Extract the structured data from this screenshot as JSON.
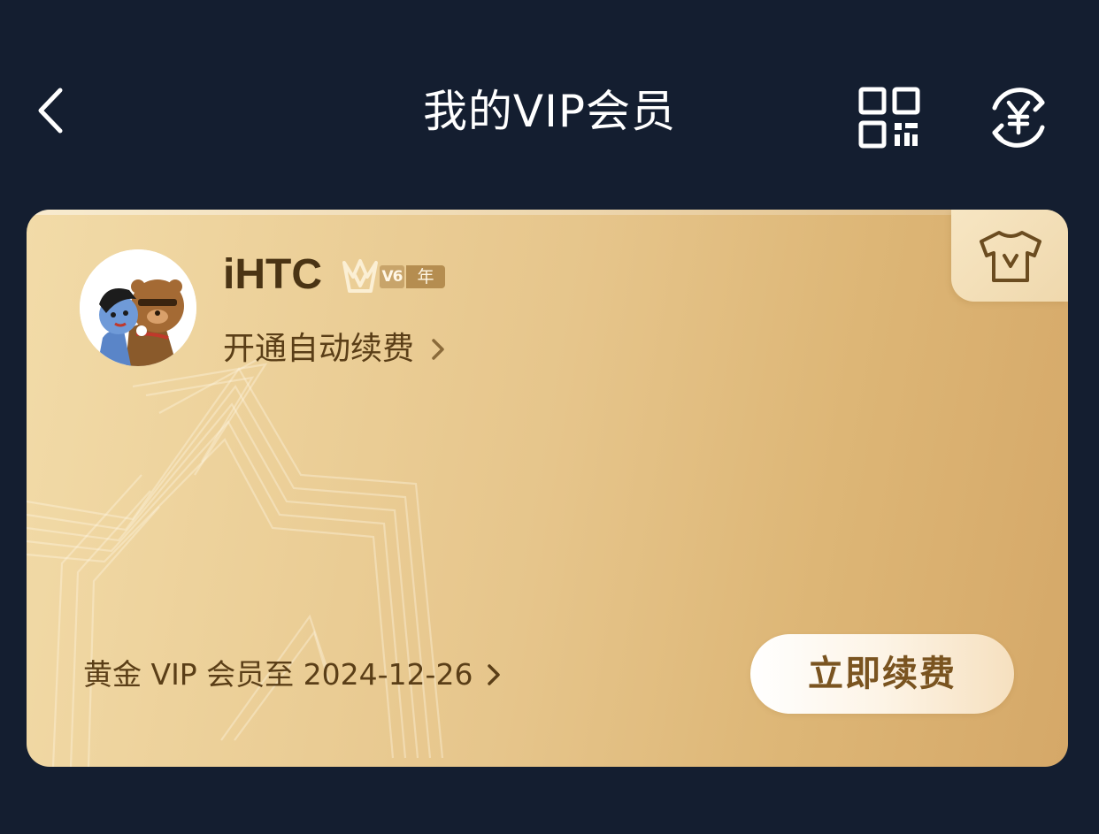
{
  "header": {
    "title": "我的VIP会员",
    "back_icon": "chevron-left-icon",
    "qr_icon": "qr-code-icon",
    "coin_icon": "yuan-refresh-icon"
  },
  "card": {
    "username": "iHTC",
    "badge": {
      "level": "V6",
      "suffix": "年"
    },
    "auto_renew_label": "开通自动续费",
    "corner_icon": "tshirt-v-icon",
    "expiry_text": "黄金 VIP 会员至 2024-12-26",
    "renew_button_label": "立即续费",
    "colors": {
      "card_gradient_start": "#f2dba8",
      "card_gradient_end": "#d5a868",
      "text_brown": "#5a3e17",
      "background": "#141e30"
    }
  }
}
